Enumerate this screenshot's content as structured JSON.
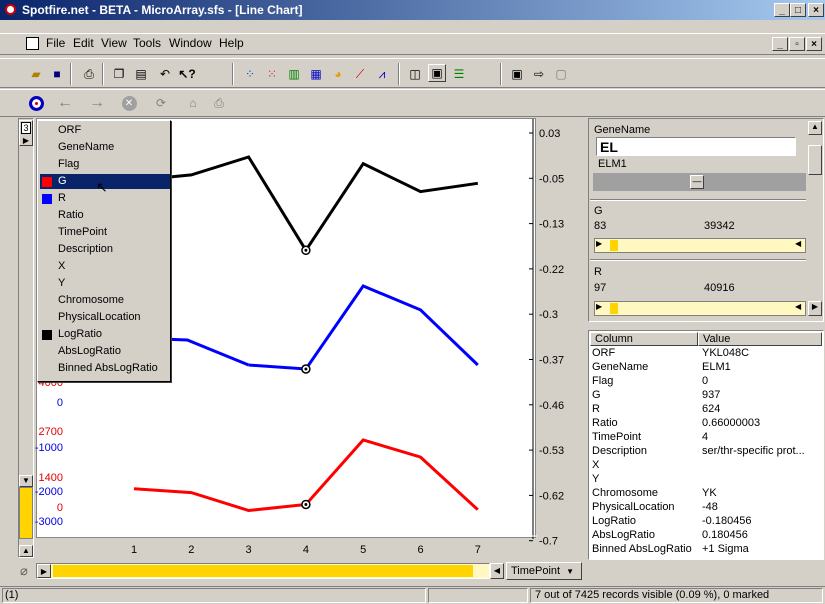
{
  "window": {
    "title": "Spotfire.net - BETA - MicroArray.sfs - [Line Chart]"
  },
  "menu": {
    "items": [
      "File",
      "Edit",
      "View",
      "Tools",
      "Window",
      "Help"
    ]
  },
  "column_menu": {
    "items": [
      {
        "label": "ORF",
        "swatch": ""
      },
      {
        "label": "GeneName",
        "swatch": ""
      },
      {
        "label": "Flag",
        "swatch": ""
      },
      {
        "label": "G",
        "swatch": "#ff0000"
      },
      {
        "label": "R",
        "swatch": "#0000ff"
      },
      {
        "label": "Ratio",
        "swatch": ""
      },
      {
        "label": "TimePoint",
        "swatch": ""
      },
      {
        "label": "Description",
        "swatch": ""
      },
      {
        "label": "X",
        "swatch": ""
      },
      {
        "label": "Y",
        "swatch": ""
      },
      {
        "label": "Chromosome",
        "swatch": ""
      },
      {
        "label": "PhysicalLocation",
        "swatch": ""
      },
      {
        "label": "LogRatio",
        "swatch": "#000000"
      },
      {
        "label": "AbsLogRatio",
        "swatch": ""
      },
      {
        "label": "Binned AbsLogRatio",
        "swatch": ""
      }
    ],
    "selected_index": 3,
    "toggle_label": "3"
  },
  "chart_data": {
    "type": "line",
    "x": [
      1,
      2,
      3,
      4,
      5,
      6,
      7
    ],
    "xlabel": "TimePoint",
    "series": [
      {
        "name": "LogRatio",
        "color": "#000000",
        "values": [
          -0.055,
          -0.045,
          -0.013,
          -0.18,
          -0.025,
          -0.075,
          -0.06
        ]
      },
      {
        "name": "R",
        "color": "#0000ff",
        "values": [
          null,
          null,
          -7500,
          -8000,
          2400,
          -600,
          -7500
        ]
      },
      {
        "name": "G",
        "color": "#ff0000",
        "values": [
          1000,
          850,
          170,
          400,
          2850,
          2200,
          200
        ]
      }
    ],
    "right_axis_ticks": [
      "0.03",
      "-0.05",
      "-0.13",
      "-0.22",
      "-0.3",
      "-0.37",
      "-0.46",
      "-0.53",
      "-0.62",
      "-0.7"
    ],
    "left_axis_red_ticks": [
      "4000",
      "2700",
      "1400",
      "0"
    ],
    "left_axis_blue_ticks": [
      "0",
      "-1000",
      "-2000",
      "-3000"
    ],
    "marked_x": 4
  },
  "filters": {
    "genename": {
      "label": "GeneName",
      "value": "EL",
      "match": "ELM1"
    },
    "g": {
      "label": "G",
      "min": "83",
      "max": "39342"
    },
    "r": {
      "label": "R",
      "min": "97",
      "max": "40916"
    }
  },
  "details": {
    "headers": [
      "Column",
      "Value"
    ],
    "rows": [
      [
        "ORF",
        "YKL048C"
      ],
      [
        "GeneName",
        "ELM1"
      ],
      [
        "Flag",
        "0"
      ],
      [
        "G",
        "937"
      ],
      [
        "R",
        "624"
      ],
      [
        "Ratio",
        "0.66000003"
      ],
      [
        "TimePoint",
        "4"
      ],
      [
        "Description",
        "ser/thr-specific prot..."
      ],
      [
        "X",
        ""
      ],
      [
        "Y",
        ""
      ],
      [
        "Chromosome",
        "YK"
      ],
      [
        "PhysicalLocation",
        "-48"
      ],
      [
        "LogRatio",
        "-0.180456"
      ],
      [
        "AbsLogRatio",
        "0.180456"
      ],
      [
        "Binned AbsLogRatio",
        "+1 Sigma"
      ]
    ]
  },
  "xaxis_selector": {
    "label": "TimePoint"
  },
  "statusbar": {
    "left": "(1)",
    "right": "7 out of 7425 records visible (0.09 %), 0 marked"
  }
}
